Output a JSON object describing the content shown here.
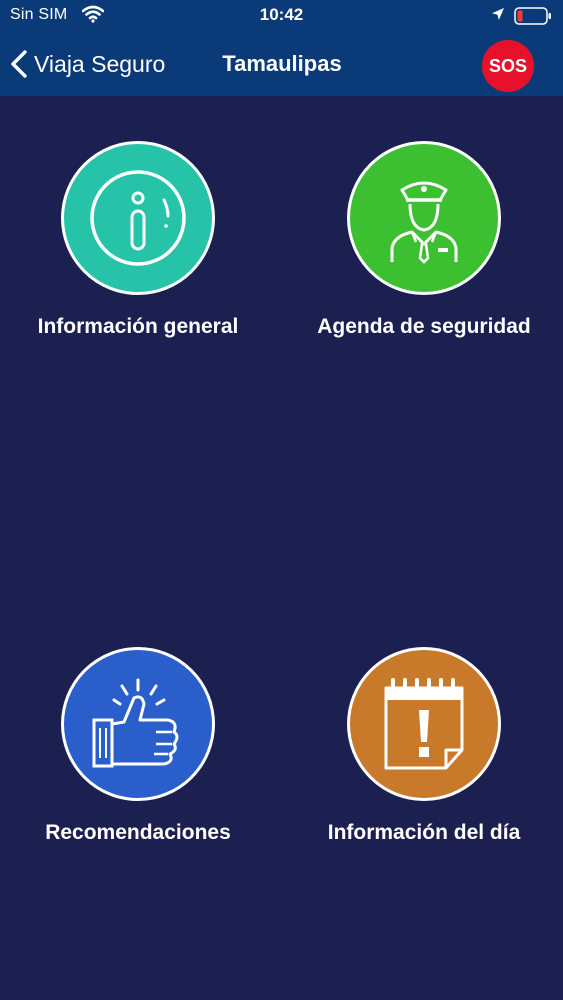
{
  "status_bar": {
    "carrier": "Sin SIM",
    "time": "10:42",
    "icons": [
      "wifi-icon",
      "location-arrow-icon",
      "battery-low-icon"
    ]
  },
  "nav": {
    "back_label": "Viaja Seguro",
    "title": "Tamaulipas",
    "sos_label": "SOS"
  },
  "colors": {
    "background": "#1b2050",
    "header": "#0b3a78",
    "sos": "#e8112b",
    "info_general": "#27c3a8",
    "agenda": "#3cc031",
    "recomendaciones": "#2a5fcb",
    "info_dia": "#c9792a"
  },
  "tiles": [
    {
      "label": "Información general",
      "icon": "info-icon"
    },
    {
      "label": "Agenda de seguridad",
      "icon": "police-officer-icon"
    },
    {
      "label": "Recomendaciones",
      "icon": "thumbs-up-icon"
    },
    {
      "label": "Información del día",
      "icon": "calendar-alert-icon"
    }
  ]
}
